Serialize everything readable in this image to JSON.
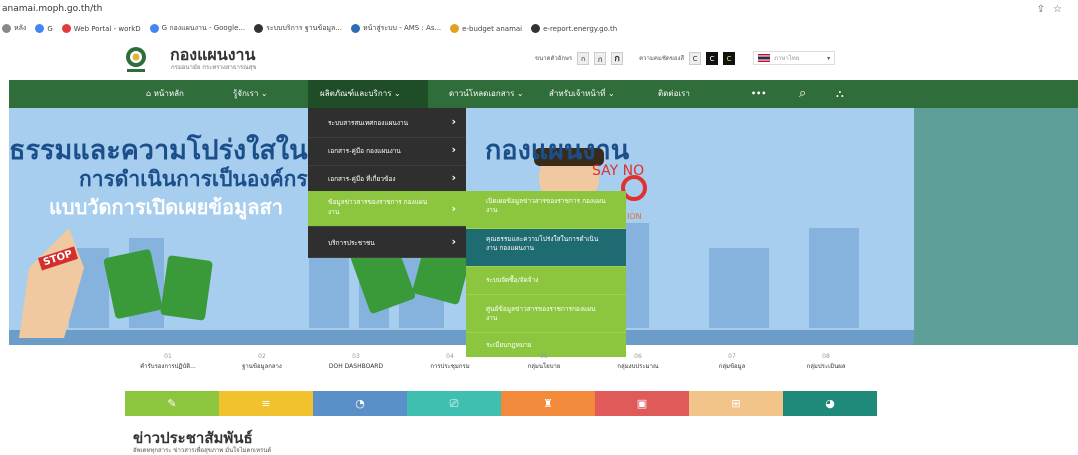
{
  "browser": {
    "url": "anamai.moph.go.th/th",
    "bookmarks": [
      {
        "label": "หลัง",
        "color": "#888888"
      },
      {
        "label": "G",
        "color": "#4285f4"
      },
      {
        "label": "Web Portal - workD",
        "color": "#e33b3b"
      },
      {
        "label": "G  กองแผนงาน - Google...",
        "color": "#4285f4"
      },
      {
        "label": "ระบบบริการ ฐานข้อมูล...",
        "color": "#333333"
      },
      {
        "label": "หน้าสู่ระบบ - AMS : As...",
        "color": "#2a6fb5"
      },
      {
        "label": "e-budget anamai",
        "color": "#e2a020"
      },
      {
        "label": "e-report.energy.go.th",
        "color": "#333333"
      }
    ]
  },
  "header": {
    "org_name": "กองแผนงาน",
    "org_sub": "กรมอนามัย กระทรวงสาธารณสุข",
    "font_size_label": "ขนาดตัวอักษร",
    "font_buttons": [
      "ก",
      "ก",
      "ก"
    ],
    "contrast_label": "ความคมชัดของสี",
    "contrast_buttons": [
      "C",
      "C",
      "C"
    ],
    "language": "ภาษาไทย"
  },
  "nav": {
    "home": "หน้าหลัก",
    "about": "รู้จักเรา",
    "products": "ผลิตภัณฑ์และบริการ",
    "download": "ดาวน์โหลดเอกสาร",
    "staff": "สำหรับเจ้าหน้าที่",
    "contact": "ติดต่อเรา",
    "more": "•••"
  },
  "banner": {
    "line1a": "ธรรมและความโปร่งใสในก",
    "line1b": "กองแผนงาน",
    "line2": "การดำเนินการเป็นองค์กร",
    "line3": "แบบวัดการเปิดเผยข้อมูลสา",
    "sign_stop": "STOP",
    "sign_sayno": "SAY NO",
    "sign_ion": "ION"
  },
  "dropdown_products": [
    "ระบบสารสนเทศกองแผนงาน",
    "เอกสาร-คู่มือ กองแผนงาน",
    "เอกสาร-คู่มือ ที่เกี่ยวข้อง",
    "ข้อมูลข่าวสารของราชการ กองแผนงาน",
    "บริการประชาชน"
  ],
  "dropdown_info": [
    "เปิดเผยข้อมูลข่าวสารของราชการ กองแผนงาน",
    "คุณธรรมและความโปร่งใสในการดำเนินงาน กองแผนงาน",
    "ระบบจัดซื้อ/จัดจ้าง",
    "ศูนย์ข้อมูลข่าวสารของราชการกองแผนงาน",
    "ระเบียบกฎหมาย"
  ],
  "shortcuts": [
    {
      "num": "01",
      "label": "คำรับรองการปฏิบัติ...",
      "color": "#8cc63f",
      "icon": "✎"
    },
    {
      "num": "02",
      "label": "ฐานข้อมูลกลาง",
      "color": "#f2c12e",
      "icon": "≡"
    },
    {
      "num": "03",
      "label": "DOH DASHBOARD",
      "color": "#5b8fc7",
      "icon": "◔"
    },
    {
      "num": "04",
      "label": "การประชุมกรม",
      "color": "#3fbfb0",
      "icon": "⎚"
    },
    {
      "num": "05",
      "label": "กลุ่มนโยบาย",
      "color": "#f28a3c",
      "icon": "♜"
    },
    {
      "num": "06",
      "label": "กลุ่มงบประมาณ",
      "color": "#e05a5a",
      "icon": "▣"
    },
    {
      "num": "07",
      "label": "กลุ่มข้อมูล",
      "color": "#f3c48a",
      "icon": "⊞"
    },
    {
      "num": "08",
      "label": "กลุ่มประเมินผล",
      "color": "#1f8a7a",
      "icon": "◕"
    }
  ],
  "news": {
    "title": "ข่าวประชาสัมพันธ์",
    "subtitle": "อัพเดททุกสาระ ข่าวสารเพื่อสุขภาพ มั่นใจไม่ตกเทรนด์"
  }
}
